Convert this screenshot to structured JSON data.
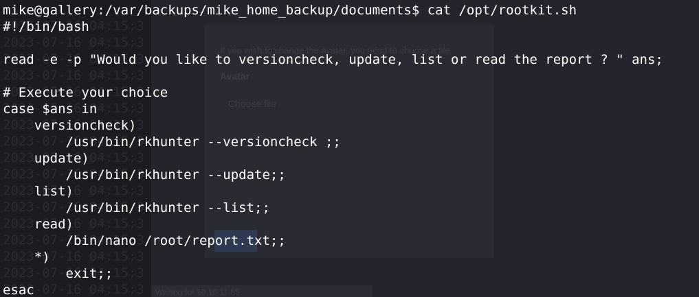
{
  "terminal": {
    "prompt": "mike@gallery:/var/backups/mike_home_backup/documents$ cat /opt/rootkit.sh",
    "lines": [
      "#!/bin/bash",
      "",
      "read -e -p \"Would you like to versioncheck, update, list or read the report ? \" ans;",
      "",
      "# Execute your choice",
      "case $ans in",
      "    versioncheck)",
      "        /usr/bin/rkhunter --versioncheck ;;",
      "    update)",
      "        /usr/bin/rkhunter --update;;",
      "    list)",
      "        /usr/bin/rkhunter --list;;",
      "    read)",
      "        /bin/nano /root/report.txt;;",
      "    *)",
      "        exit;;",
      "esac"
    ]
  },
  "background": {
    "ghost_hint": "If you wish to change the avatar, you need to choose a file",
    "ghost_avatar_label": "Avatar",
    "ghost_choose_file": "Choose file",
    "ghost_status": "Waiting for 10.10.11.85",
    "ghost_timestamp": "2023-07-16 04:15:3"
  }
}
